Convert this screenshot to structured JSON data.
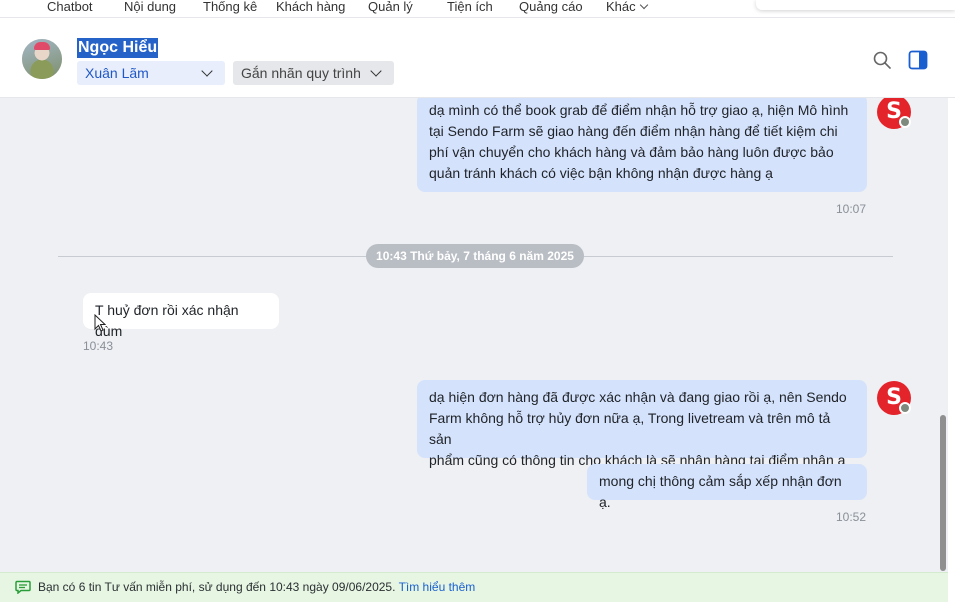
{
  "nav": {
    "items": [
      "Chatbot",
      "Nội dung",
      "Thống kê",
      "Khách hàng",
      "Quản lý",
      "Tiện ích",
      "Quảng cáo",
      "Khác"
    ]
  },
  "header": {
    "contact_name": "Ngọc Hiểu",
    "assignee": "Xuân Lãm",
    "label_placeholder": "Gắn nhãn quy trình"
  },
  "messages": [
    {
      "direction": "out",
      "text": "dạ mình có thể book grab để điểm nhận hỗ trợ giao ạ, hiện Mô hình\ntại Sendo Farm sẽ giao hàng đến điểm nhận hàng để tiết kiệm chi\nphí vận chuyển cho khách hàng và đảm bảo hàng luôn được bảo\nquản tránh khách có việc bận không nhận được hàng ạ",
      "time": "10:07"
    },
    {
      "direction": "in",
      "text": "T huỷ đơn rồi xác nhận dùm",
      "time": "10:43"
    },
    {
      "direction": "out",
      "text": "dạ hiện đơn hàng đã được xác nhận và đang giao rồi ạ, nên Sendo\nFarm không hỗ trợ hủy đơn nữa ạ, Trong livetream và trên mô tả sản\nphẩm cũng có thông tin cho khách là sẽ nhận hàng tại điểm nhận ạ"
    },
    {
      "direction": "out",
      "text": "mong chị thông cảm sắp xếp nhận đơn ạ.",
      "time": "10:52"
    }
  ],
  "date_divider": "10:43 Thứ bảy, 7 tháng 6 năm 2025",
  "banner": {
    "text": "Bạn có 6 tin Tư vấn miễn phí, sử dụng đến 10:43 ngày 09/06/2025.",
    "link": "Tìm hiểu thêm"
  },
  "colors": {
    "accent": "#2563c9",
    "outgoing_bubble": "#d4e2fc",
    "sendo_red": "#e3242b",
    "banner_bg": "#e6f6e2"
  }
}
